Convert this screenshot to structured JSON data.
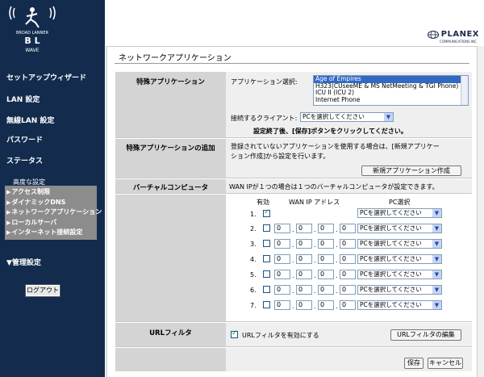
{
  "brand": {
    "logo_text_top": "BROAD LANNER",
    "logo_text_bottom": "WAVE",
    "logo_letters": "B L",
    "vendor": "PLANEX",
    "vendor_sub": "COMMUNICATIONS INC."
  },
  "sidebar": {
    "items": [
      {
        "label": "セットアップウィザード"
      },
      {
        "label": "LAN 設定"
      },
      {
        "label": "無線LAN 設定"
      },
      {
        "label": "パスワード"
      },
      {
        "label": "ステータス"
      }
    ],
    "advanced_label": "高度な設定",
    "submenu": [
      {
        "label": "アクセス制限"
      },
      {
        "label": "ダイナミックDNS"
      },
      {
        "label": "ネットワークアプリケーション"
      },
      {
        "label": "ローカルサーバ"
      },
      {
        "label": "インターネット接続設定"
      }
    ],
    "admin_label": "▼管理設定",
    "logout_label": "ログアウト"
  },
  "page": {
    "title": "ネットワークアプリケーション"
  },
  "special_app": {
    "section_label": "特殊アプリケーション",
    "select_label": "アプリケーション選択:",
    "options": [
      "Age of Empires",
      "H323(CUseeME & MS NetMeeting & TGI Phone)",
      "ICU II (ICU 2)",
      "Internet Phone"
    ],
    "selected_index": 0,
    "client_label": "接続するクライアント:",
    "client_value": "PCを選択してください",
    "note": "設定終了後、[保存]ボタンをクリックしてください。"
  },
  "add_app": {
    "section_label": "特殊アプリケーションの追加",
    "description": "登録されていないアプリケーションを使用する場合は、[新規アプリケーション作成]から設定を行います。",
    "description_line1": "登録されていないアプリケーションを使用する場合は、[新規アプリケー",
    "description_line2": "ション作成]から設定を行います。",
    "button_label": "新規アプリケーション作成"
  },
  "virtual_computer": {
    "section_label": "バーチャルコンピュータ",
    "description": "WAN IPが１つの場合は１つのバーチャルコンピュータが設定できます。",
    "col_enabled": "有効",
    "col_wan_ip": "WAN IP アドレス",
    "col_pc": "PC選択",
    "rows": [
      {
        "num": "1.",
        "enabled": true,
        "ip": null,
        "pc": "PCを選択してください"
      },
      {
        "num": "2.",
        "enabled": false,
        "ip": [
          "0",
          "0",
          "0",
          "0"
        ],
        "pc": "PCを選択してください"
      },
      {
        "num": "3.",
        "enabled": false,
        "ip": [
          "0",
          "0",
          "0",
          "0"
        ],
        "pc": "PCを選択してください"
      },
      {
        "num": "4.",
        "enabled": false,
        "ip": [
          "0",
          "0",
          "0",
          "0"
        ],
        "pc": "PCを選択してください"
      },
      {
        "num": "5.",
        "enabled": false,
        "ip": [
          "0",
          "0",
          "0",
          "0"
        ],
        "pc": "PCを選択してください"
      },
      {
        "num": "6.",
        "enabled": false,
        "ip": [
          "0",
          "0",
          "0",
          "0"
        ],
        "pc": "PCを選択してください"
      },
      {
        "num": "7.",
        "enabled": false,
        "ip": [
          "0",
          "0",
          "0",
          "0"
        ],
        "pc": "PCを選択してください"
      }
    ]
  },
  "url_filter": {
    "section_label": "URLフィルタ",
    "checkbox_label": "URLフィルタを有効にする",
    "enabled": true,
    "edit_button": "URLフィルタの編集"
  },
  "footer": {
    "save_label": "保存",
    "cancel_label": "キャンセル"
  },
  "colors": {
    "sidebar_bg": "#132c4e",
    "row_label_bg": "#d4d4d4",
    "cell_bg": "#efefef",
    "selection": "#316ac5"
  }
}
